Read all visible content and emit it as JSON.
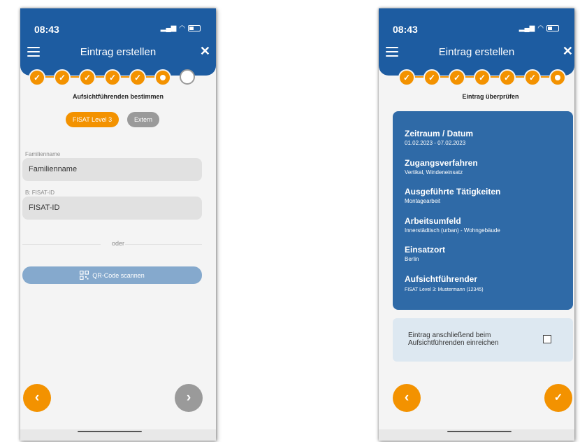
{
  "status_bar": {
    "time": "08:43"
  },
  "colors": {
    "primary": "#1d5ca1",
    "accent": "#f39200",
    "card": "#2f6aa7",
    "disabled": "#85a9cd",
    "neutral": "#9a9a9a"
  },
  "left_screen": {
    "header_title": "Eintrag erstellen",
    "step_label": "Aufsichtführenden bestimmen",
    "steps_total": 7,
    "steps_completed": 5,
    "current_step": 6,
    "level_button": "FISAT Level 3",
    "extern_button": "Extern",
    "last_name_label": "Familienname",
    "last_name_value": "Familienname",
    "id_label": "B: FISAT-ID",
    "id_value": "FISAT-ID",
    "or_text": "oder",
    "qr_button": "QR-Code scannen",
    "back_icon": "chevron-left-icon",
    "next_icon": "chevron-right-icon"
  },
  "right_screen": {
    "header_title": "Eintrag erstellen",
    "step_label": "Eintrag überprüfen",
    "steps_total": 7,
    "steps_completed": 6,
    "current_step": 7,
    "summary": [
      {
        "heading": "Zeitraum / Datum",
        "value": "01.02.2023 - 07.02.2023"
      },
      {
        "heading": "Zugangsverfahren",
        "value": "Vertikal, Windeneinsatz"
      },
      {
        "heading": "Ausgeführte Tätigkeiten",
        "value": "Montagearbeit"
      },
      {
        "heading": "Arbeitsumfeld",
        "value": "Innerstädtisch (urban) - Wohngebäude"
      },
      {
        "heading": "Einsatzort",
        "value": "Berlin"
      },
      {
        "heading": "Aufsichtführender",
        "value": "FISAT Level 3: Mustermann (12345)"
      }
    ],
    "submit_text_line1": "Eintrag anschließend beim",
    "submit_text_line2": "Aufsichtführenden einreichen",
    "submit_checked": false,
    "back_icon": "chevron-left-icon",
    "confirm_icon": "checkmark-icon"
  }
}
